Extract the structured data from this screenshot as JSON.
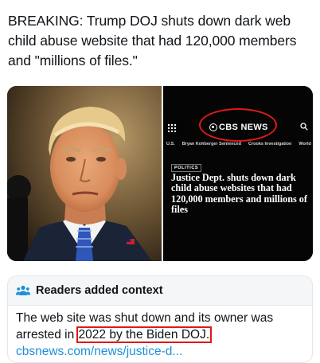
{
  "post": {
    "text": "BREAKING: Trump DOJ shuts down dark web child abuse website that had 120,000 members and \"millions of files.\""
  },
  "cbs": {
    "logo_text": "CBS NEWS",
    "nav": [
      "U.S.",
      "Bryan Kohberger Sentenced",
      "Crooks Investigation",
      "World"
    ],
    "tag": "POLITICS",
    "headline": "Justice Dept. shuts down dark child abuse websites that had 120,000 members and millions of files"
  },
  "context": {
    "title": "Readers added context",
    "text_before": "The web site was shut down and its owner was arrested in",
    "highlight": "2022 by the Biden DOJ.",
    "link": "cbsnews.com/news/justice-d..."
  },
  "colors": {
    "annotation_red": "#e01818",
    "link_blue": "#1d8fd8"
  }
}
